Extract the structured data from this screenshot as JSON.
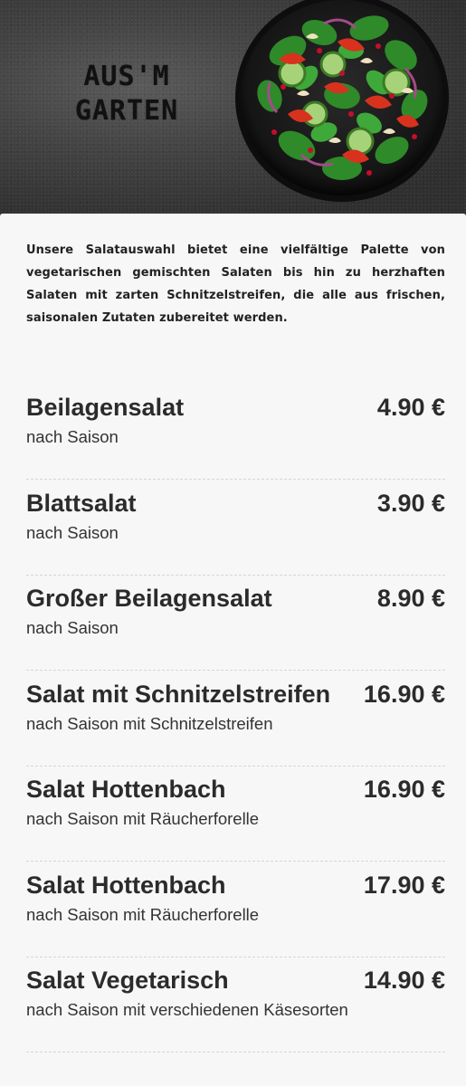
{
  "header": {
    "title_line1": "AUS'M",
    "title_line2": "GARTEN",
    "image": "salad-bowl-image"
  },
  "intro": "Unsere Salatauswahl bietet eine vielfältige Palette von vegetarischen gemischten Salaten bis hin zu herzhaften Salaten mit zarten Schnitzelstreifen, die alle aus frischen, saisonalen Zutaten zubereitet werden.",
  "items": [
    {
      "name": "Beilagensalat",
      "price": "4.90 €",
      "desc": "nach Saison"
    },
    {
      "name": "Blattsalat",
      "price": "3.90 €",
      "desc": "nach Saison"
    },
    {
      "name": "Großer Beilagensalat",
      "price": "8.90 €",
      "desc": "nach Saison"
    },
    {
      "name": "Salat mit Schnitzelstreifen",
      "price": "16.90 €",
      "desc": "nach Saison mit Schnitzelstreifen"
    },
    {
      "name": "Salat Hottenbach",
      "price": "16.90 €",
      "desc": "nach Saison mit Räucherforelle"
    },
    {
      "name": "Salat Hottenbach",
      "price": "17.90 €",
      "desc": "nach Saison mit Räucherforelle"
    },
    {
      "name": "Salat Vegetarisch",
      "price": "14.90 €",
      "desc": "nach Saison mit verschiedenen Käsesorten"
    }
  ],
  "colors": {
    "card_background": "#f7f7f7",
    "text": "#2b2b2b",
    "hero_background": "#3b3b3b"
  }
}
